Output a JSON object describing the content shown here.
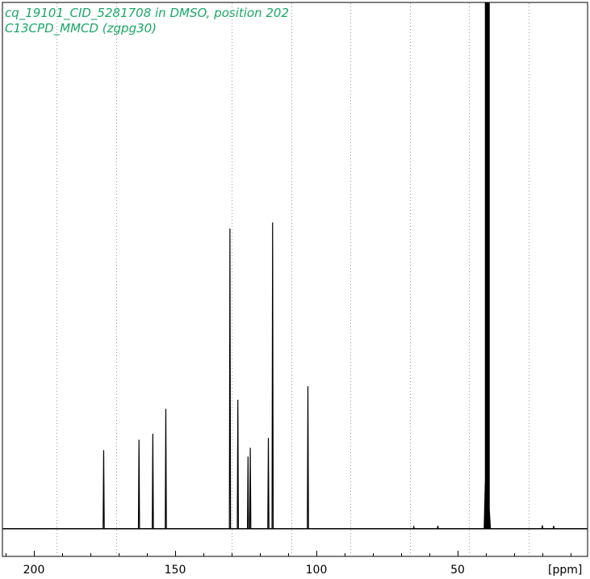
{
  "colors": {
    "title": "#1aa866",
    "spectrum": "#000000",
    "frame": "#000000",
    "grid": "#9a9a9a"
  },
  "chart_data": {
    "type": "line",
    "title_lines": [
      "cq_19101_CID_5281708 in DMSO, position 202",
      "C13CPD_MMCD (zgpg30)"
    ],
    "xlabel": "[ppm]",
    "xlim": [
      212,
      -5
    ],
    "x_reversed": true,
    "x_ticks": [
      200,
      150,
      100,
      50
    ],
    "grid": "vertical-dotted",
    "gridlines_ppm": [
      192,
      171,
      130,
      109,
      88,
      67,
      46,
      25
    ],
    "y_relative": true,
    "baseline": 0,
    "peaks": [
      {
        "ppm": 175.3,
        "height": 0.262
      },
      {
        "ppm": 162.8,
        "height": 0.297
      },
      {
        "ppm": 157.9,
        "height": 0.317
      },
      {
        "ppm": 153.3,
        "height": 0.4
      },
      {
        "ppm": 130.6,
        "height": 1.0
      },
      {
        "ppm": 127.8,
        "height": 0.43
      },
      {
        "ppm": 124.2,
        "height": 0.241
      },
      {
        "ppm": 123.4,
        "height": 0.27
      },
      {
        "ppm": 117.0,
        "height": 0.303
      },
      {
        "ppm": 115.5,
        "height": 1.02
      },
      {
        "ppm": 103.0,
        "height": 0.475
      },
      {
        "ppm": 39.5,
        "height": 1.8,
        "label": "DMSO"
      },
      {
        "ppm": 57.0,
        "height": 0.01
      },
      {
        "ppm": 65.5,
        "height": 0.007
      },
      {
        "ppm": 20.0,
        "height": 0.012
      },
      {
        "ppm": 16.0,
        "height": 0.01
      }
    ]
  }
}
